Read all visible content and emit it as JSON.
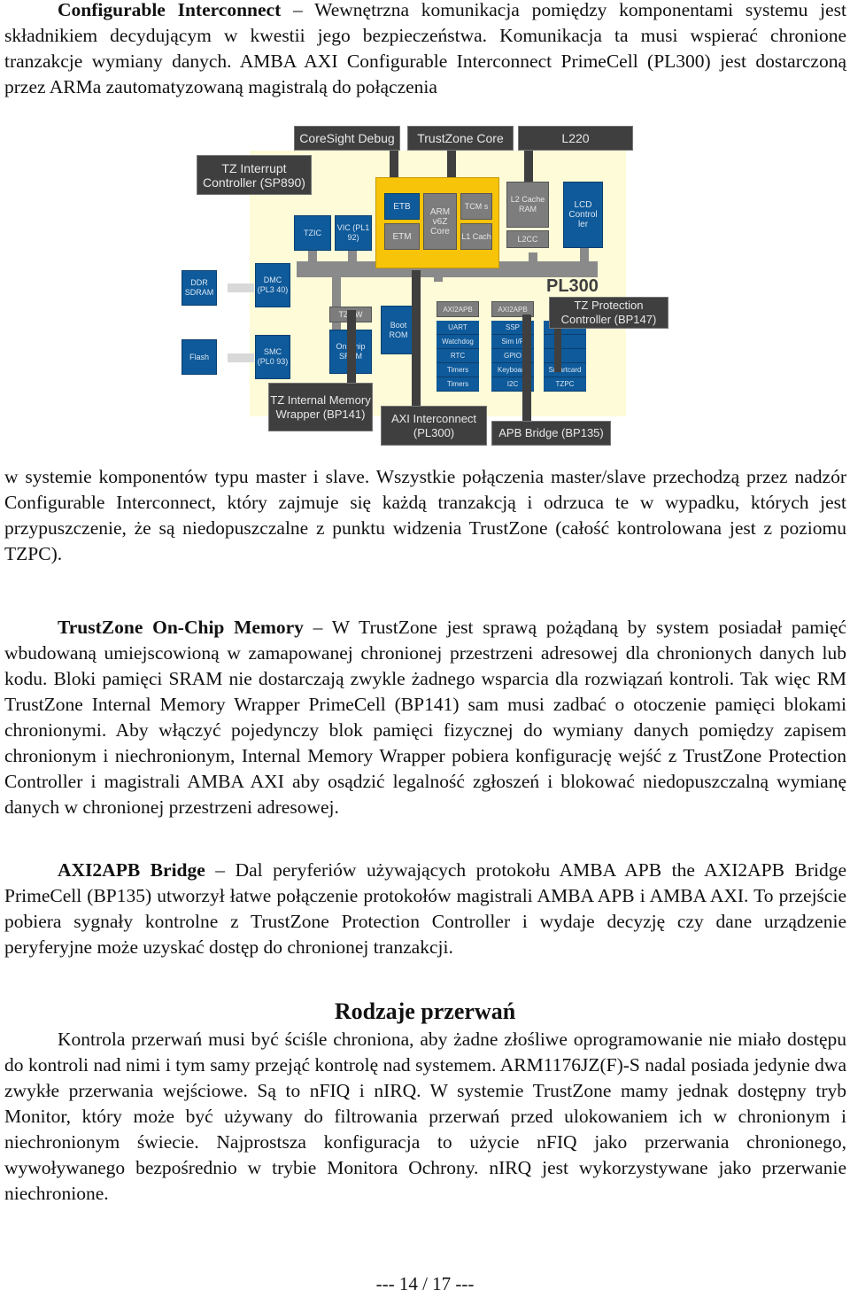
{
  "paragraphs": {
    "p1": {
      "term": "Configurable Interconnect",
      "text": " – Wewnętrzna komunikacja pomiędzy komponentami systemu jest składnikiem decydującym w kwestii jego bezpieczeństwa. Komunikacja ta musi wspierać chronione tranzakcje wymiany danych. AMBA AXI Configurable Interconnect PrimeCell (PL300) jest dostarczoną przez ARMa zautomatyzowaną magistralą do połączenia"
    },
    "p1_cont": "w systemie komponentów typu master i slave. Wszystkie połączenia master/slave przechodzą przez nadzór  Configurable Interconnect, który zajmuje się każdą tranzakcją i odrzuca te w wypadku, których jest przypuszczenie, że są niedopuszczalne z punktu widzenia TrustZone (całość kontrolowana jest z poziomu TZPC).",
    "p2": {
      "term": "TrustZone On-Chip Memory",
      "text": " – W TrustZone jest sprawą pożądaną by system posiadał pamięć wbudowaną umiejscowioną w zamapowanej chronionej przestrzeni adresowej dla chronionych danych lub kodu. Bloki pamięci SRAM nie dostarczają zwykle żadnego wsparcia dla rozwiązań kontroli. Tak więc RM TrustZone Internal Memory Wrapper PrimeCell (BP141) sam musi zadbać o otoczenie pamięci blokami chronionymi. Aby włączyć pojedynczy blok pamięci fizycznej do wymiany danych pomiędzy zapisem chronionym i niechronionym,  Internal Memory Wrapper pobiera konfigurację wejść z  TrustZone Protection Controller i magistrali AMBA AXI aby osądzić legalność zgłoszeń i blokować niedopuszczalną wymianę danych w chronionej przestrzeni adresowej."
    },
    "p3": {
      "term": "AXI2APB Bridge",
      "text": " – Dal peryferiów używających protokołu AMBA APB the AXI2APB Bridge PrimeCell (BP135) utworzył łatwe połączenie protokołów magistrali AMBA APB i AMBA AXI. To przejście pobiera sygnały kontrolne z  TrustZone Protection Controller i wydaje decyzję czy dane urządzenie peryferyjne może uzyskać dostęp do chronionej tranzakcji."
    },
    "heading": "Rodzaje przerwań",
    "p4": "Kontrola przerwań musi być ściśle chroniona, aby żadne złośliwe oprogramowanie nie miało dostępu do kontroli nad nimi i tym samy przejąć kontrolę nad systemem. ARM1176JZ(F)-S nadal posiada jedynie dwa zwykłe przerwania wejściowe. Są to  nFIQ i nIRQ. W systemie TrustZone mamy jednak dostępny tryb Monitor, który może być używany do filtrowania przerwań przed ulokowaniem ich w chronionym i niechronionym świecie. Najprostsza konfiguracja to użycie  nFIQ jako przerwania chronionego, wywoływanego bezpośrednio w trybie Monitora Ochrony.  nIRQ jest wykorzystywane jako przerwanie niechronione."
  },
  "diagram": {
    "callouts": {
      "coresight": "CoreSight Debug",
      "trustzone_core": "TrustZone Core",
      "l220": "L220",
      "tz_interrupt": "TZ Interrupt Controller (SP890)",
      "tz_protection": "TZ Protection Controller (BP147)",
      "tz_memory": "TZ Internal Memory Wrapper (BP141)",
      "axi_interconnect": "AXI Interconnect (PL300)",
      "apb_bridge": "APB Bridge (BP135)"
    },
    "blocks": {
      "tzic": "TZIC",
      "vic": "VIC (PL1 92)",
      "etb": "ETB",
      "etm": "ETM",
      "arm_core": "ARM v6Z Core",
      "tcm": "TCM s",
      "l1_cache": "L1 Cach",
      "l2_cache_ram": "L2 Cache RAM",
      "l2cc": "L2CC",
      "lcd": "LCD Control ler",
      "ddr": "DDR SDRAM",
      "dmc": "DMC (PL3 40)",
      "flash": "Flash",
      "smc": "SMC (PL0 93)",
      "tzmw": "TZMW",
      "onchip_sram": "On Chip SRAM",
      "boot_rom": "Boot ROM",
      "axi2apb_1": "AXI2APB",
      "axi2apb_2": "AXI2APB",
      "bus_label": "PL300"
    },
    "peripherals_1": [
      "UART",
      "Watchdog",
      "RTC",
      "Timers",
      "Timers"
    ],
    "peripherals_2": [
      "SSP",
      "Sim I/F",
      "GPIO",
      "Keyboard",
      "I2C"
    ],
    "peripherals_3": [
      "",
      "",
      "",
      "Smartcard",
      "TZPC"
    ]
  },
  "footer": "--- 14 / 17 ---"
}
